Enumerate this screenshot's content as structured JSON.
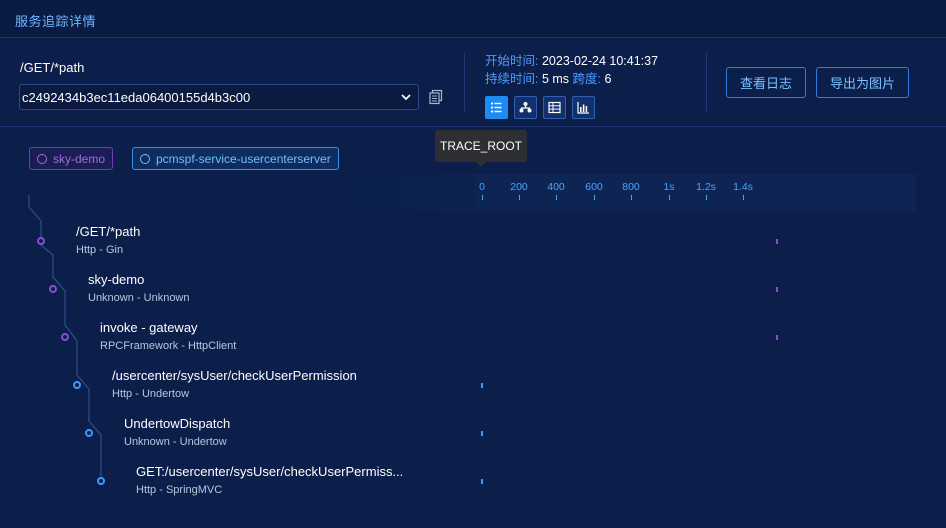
{
  "header": {
    "title": "服务追踪详情"
  },
  "trace": {
    "endpoint": "/GET/*path",
    "trace_id": "c2492434b3ec11eda06400155d4b3c00"
  },
  "meta": {
    "start_label": "开始时间:",
    "start_value": "2023-02-24 10:41:37",
    "duration_label": "持续时间:",
    "duration_value": "5 ms",
    "span_label": "跨度:",
    "span_value": "6"
  },
  "view_modes": [
    {
      "name": "list",
      "icon": "list-icon",
      "active": true
    },
    {
      "name": "tree",
      "icon": "tree-icon",
      "active": false
    },
    {
      "name": "table",
      "icon": "table-icon",
      "active": false
    },
    {
      "name": "statistics",
      "icon": "bar-chart-icon",
      "active": false
    }
  ],
  "actions": {
    "view_logs": "查看日志",
    "export_image": "导出为图片"
  },
  "tooltip": "TRACE_ROOT",
  "services": [
    {
      "name": "sky-demo",
      "color": "#9d6ee0"
    },
    {
      "name": "pcmspf-service-usercenterserver",
      "color": "#6cc0ff"
    }
  ],
  "timeline": {
    "ticks": [
      "0",
      "200",
      "400",
      "600",
      "800",
      "1s",
      "1.2s",
      "1.4s"
    ]
  },
  "spans": [
    {
      "name": "/GET/*path",
      "sub": "Http - Gin",
      "service": "sky-demo",
      "color": "#8a4fd0"
    },
    {
      "name": "sky-demo",
      "sub": "Unknown - Unknown",
      "service": "sky-demo",
      "color": "#8a4fd0"
    },
    {
      "name": "invoke - gateway",
      "sub": "RPCFramework - HttpClient",
      "service": "sky-demo",
      "color": "#8a4fd0"
    },
    {
      "name": "/usercenter/sysUser/checkUserPermission",
      "sub": "Http - Undertow",
      "service": "pcmspf-service-usercenterserver",
      "color": "#3a9bff"
    },
    {
      "name": "UndertowDispatch",
      "sub": "Unknown - Undertow",
      "service": "pcmspf-service-usercenterserver",
      "color": "#3a9bff"
    },
    {
      "name": "GET:/usercenter/sysUser/checkUserPermiss...",
      "sub": "Http - SpringMVC",
      "service": "pcmspf-service-usercenterserver",
      "color": "#3a9bff"
    }
  ]
}
